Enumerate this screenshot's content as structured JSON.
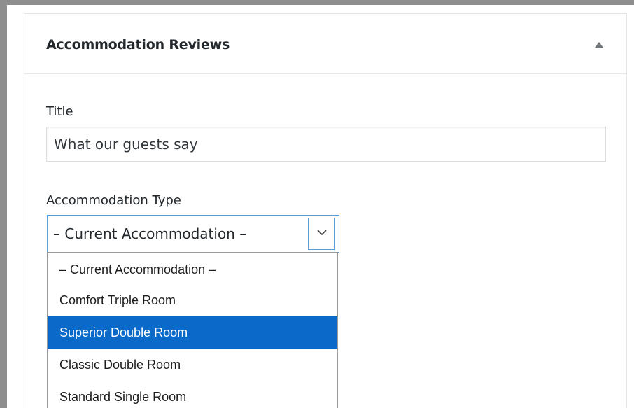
{
  "widget": {
    "title": "Accommodation Reviews"
  },
  "fields": {
    "title_label": "Title",
    "title_value": "What our guests say",
    "type_label": "Accommodation Type",
    "type_selected": "– Current Accommodation –"
  },
  "dropdown": {
    "options": [
      {
        "label": "– Current Accommodation –",
        "highlighted": false
      },
      {
        "label": "Comfort Triple Room",
        "highlighted": false
      },
      {
        "label": "Superior Double Room",
        "highlighted": true
      },
      {
        "label": "Classic Double Room",
        "highlighted": false
      },
      {
        "label": "Standard Single Room",
        "highlighted": false
      }
    ]
  },
  "icons": {
    "collapse": "triangle-up-icon",
    "select_arrow": "chevron-down-icon"
  },
  "colors": {
    "highlight": "#0b6ac9",
    "focus_border": "#5b9dd9",
    "text": "#23282d",
    "frame": "#8e8e8e"
  }
}
